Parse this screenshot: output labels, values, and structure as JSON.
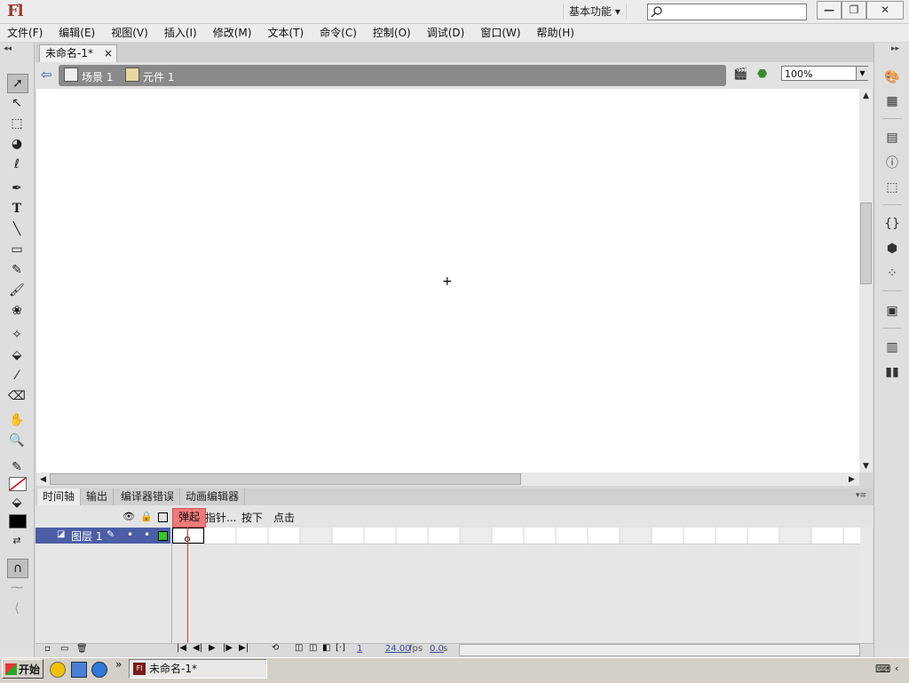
{
  "app": {
    "logo": "Fl",
    "workspace": "基本功能 ▾",
    "search_placeholder": ""
  },
  "window_controls": {
    "minimize": "—",
    "restore": "❐",
    "close": "✕"
  },
  "menubar": [
    "文件(F)",
    "编辑(E)",
    "视图(V)",
    "插入(I)",
    "修改(M)",
    "文本(T)",
    "命令(C)",
    "控制(O)",
    "调试(D)",
    "窗口(W)",
    "帮助(H)"
  ],
  "document": {
    "tab_title": "未命名-1*",
    "tab_close": "×"
  },
  "breadcrumb": {
    "scene": "场景 1",
    "symbol": "元件 1"
  },
  "zoom": "100%",
  "timeline": {
    "tabs": [
      "时间轴",
      "输出",
      "编译器错误",
      "动画编辑器"
    ],
    "frame_labels": [
      "弹起",
      "指针...",
      "按下",
      "点击"
    ],
    "layer_name": "图层 1",
    "status": {
      "frame": "1",
      "fps": "24.00",
      "fps_unit": "fps",
      "time": "0.0",
      "time_unit": "s"
    }
  },
  "taskbar": {
    "start": "开始",
    "task": "未命名-1*",
    "more": "»"
  },
  "icons": {
    "tools": [
      "selection-icon",
      "subselection-icon",
      "free-transform-icon",
      "3d-rotation-icon",
      "lasso-icon",
      "pen-icon",
      "text-icon",
      "line-icon",
      "rectangle-icon",
      "pencil-icon",
      "brush-icon",
      "deco-icon",
      "bone-icon",
      "paint-bucket-icon",
      "eyedropper-icon",
      "eraser-icon",
      "hand-icon",
      "zoom-icon",
      "stroke-color-icon",
      "fill-color-icon",
      "snap-icon"
    ],
    "right_panel": [
      "color-icon",
      "swatches-icon",
      "align-icon",
      "info-icon",
      "transform-icon",
      "code-snippets-icon",
      "components-icon",
      "motion-presets-icon",
      "project-icon",
      "library-icon",
      "movie-explorer-icon"
    ]
  },
  "colors": {
    "layer_highlight": "#4b5ea6",
    "playhead": "#e03030",
    "popup_label": "#f07a7a"
  }
}
